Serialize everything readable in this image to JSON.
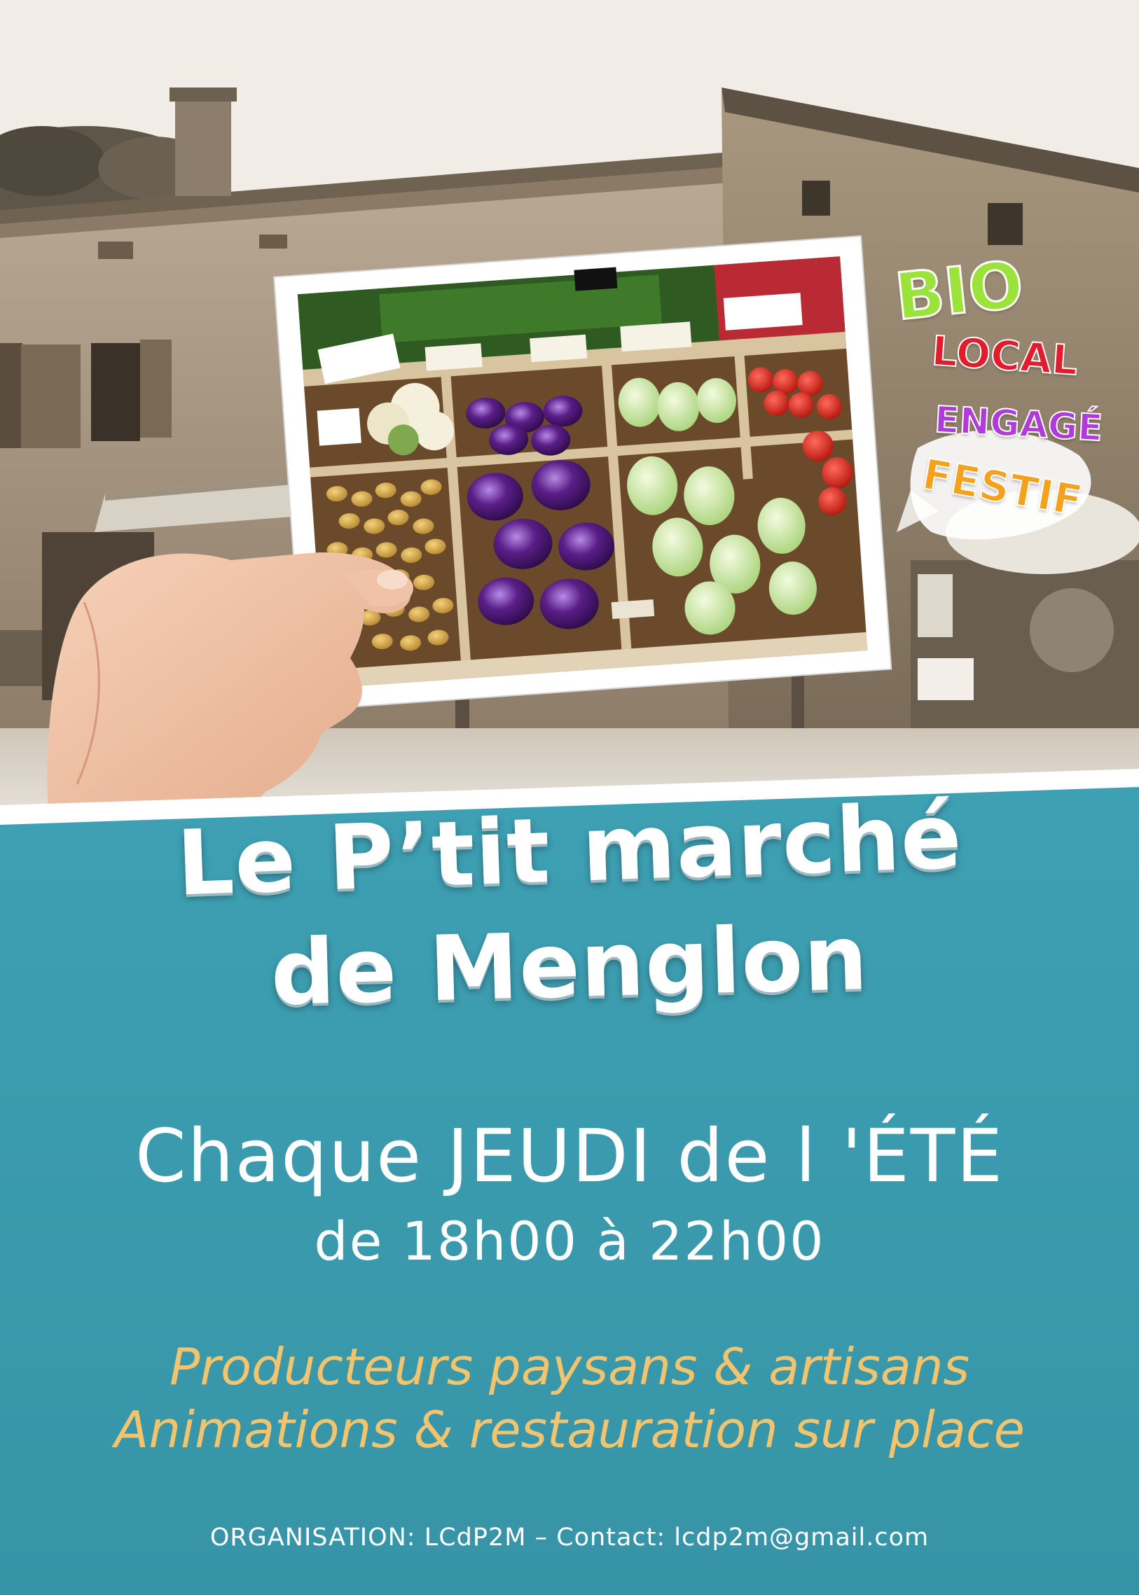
{
  "tags": {
    "bio": "BIO",
    "local": "LOCAL",
    "engage": "ENGAGÉ",
    "festif": "FESTIF"
  },
  "title": {
    "line1": "Le P’tit marché",
    "line2": "de Menglon"
  },
  "schedule": {
    "day": "Chaque JEUDI de l 'ÉTÉ",
    "hours": "de 18h00 à 22h00"
  },
  "offers": {
    "line1": "Producteurs paysans & artisans",
    "line2": "Animations & restauration sur place"
  },
  "footer": "ORGANISATION: LCdP2M – Contact: lcdp2m@gmail.com",
  "colors": {
    "panel_blue": "#3b9bae",
    "offer_gold": "#f2c46e",
    "bio_green": "#9be33a",
    "local_red": "#e21d2b",
    "engage_purple": "#b03bd9",
    "festif_orange": "#f4a21d"
  }
}
